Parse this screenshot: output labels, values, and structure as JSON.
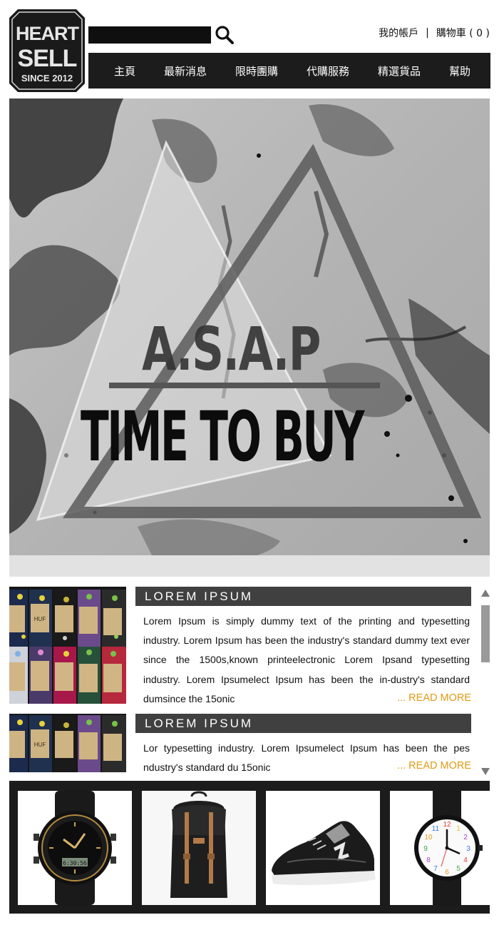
{
  "brand": {
    "logo_line1": "HEART",
    "logo_line2": "SELL",
    "logo_line3": "SINCE 2012"
  },
  "search": {
    "value": "",
    "placeholder": ""
  },
  "account": {
    "my_account": "我的帳戶",
    "separator": "|",
    "cart_label": "購物車",
    "cart_count": "( 0 )"
  },
  "nav": {
    "items": [
      "主頁",
      "最新消息",
      "限時團購",
      "代購服務",
      "精選貨品",
      "幫助"
    ]
  },
  "hero": {
    "line1": "A.S.A.P",
    "line2": "TIME TO BUY"
  },
  "articles": [
    {
      "title": "LOREM IPSUM",
      "body": "Lorem Ipsum is simply dummy text of the printing and typesetting industry. Lorem Ipsum has been the industry's standard dummy text ever since the 1500s,known printeelectronic Lorem Ipsand typesetting industry. Lorem Ipsumelect  Ipsum has been the in-dustry's standard dumsince the 15onic",
      "read_more": "... READ MORE",
      "thumb_label": "HUF"
    },
    {
      "title": "LOREM IPSUM",
      "body": "Lor typesetting industry. Lorem Ipsumelect  Ipsum has been the pes ndustry's standard du 15onic",
      "read_more": "... READ MORE",
      "thumb_label": "HUF"
    }
  ],
  "products": [
    {
      "icon": "digital-watch-icon",
      "dial_text": "6:30:56"
    },
    {
      "icon": "backpack-icon"
    },
    {
      "icon": "sneaker-icon"
    },
    {
      "icon": "analog-watch-icon"
    }
  ],
  "colors": {
    "nav_bg": "#1c1c1c",
    "header_bar": "#404040",
    "read_more": "#e09b14",
    "scroll_thumb": "#9a9a9a"
  }
}
